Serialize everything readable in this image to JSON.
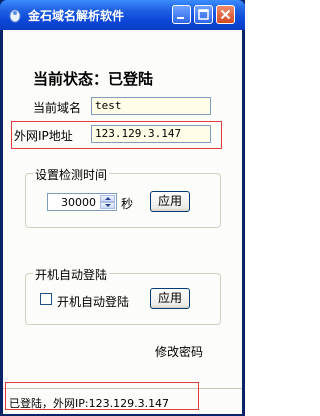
{
  "window": {
    "title": "金石域名解析软件"
  },
  "status_heading": "当前状态：已登陆",
  "domain": {
    "label": "当前域名",
    "value": "test"
  },
  "ip": {
    "label": "外网IP地址",
    "value": "123.129.3.147"
  },
  "interval_group": {
    "title": "设置检测时间",
    "value": "30000",
    "unit": "秒",
    "apply_label": "应用"
  },
  "autologin_group": {
    "title": "开机自动登陆",
    "checkbox_label": "开机自动登陆",
    "checked": false,
    "apply_label": "应用"
  },
  "change_password_link": "修改密码",
  "status_bar": {
    "text": "已登陆，外网IP:123.129.3.147"
  }
}
